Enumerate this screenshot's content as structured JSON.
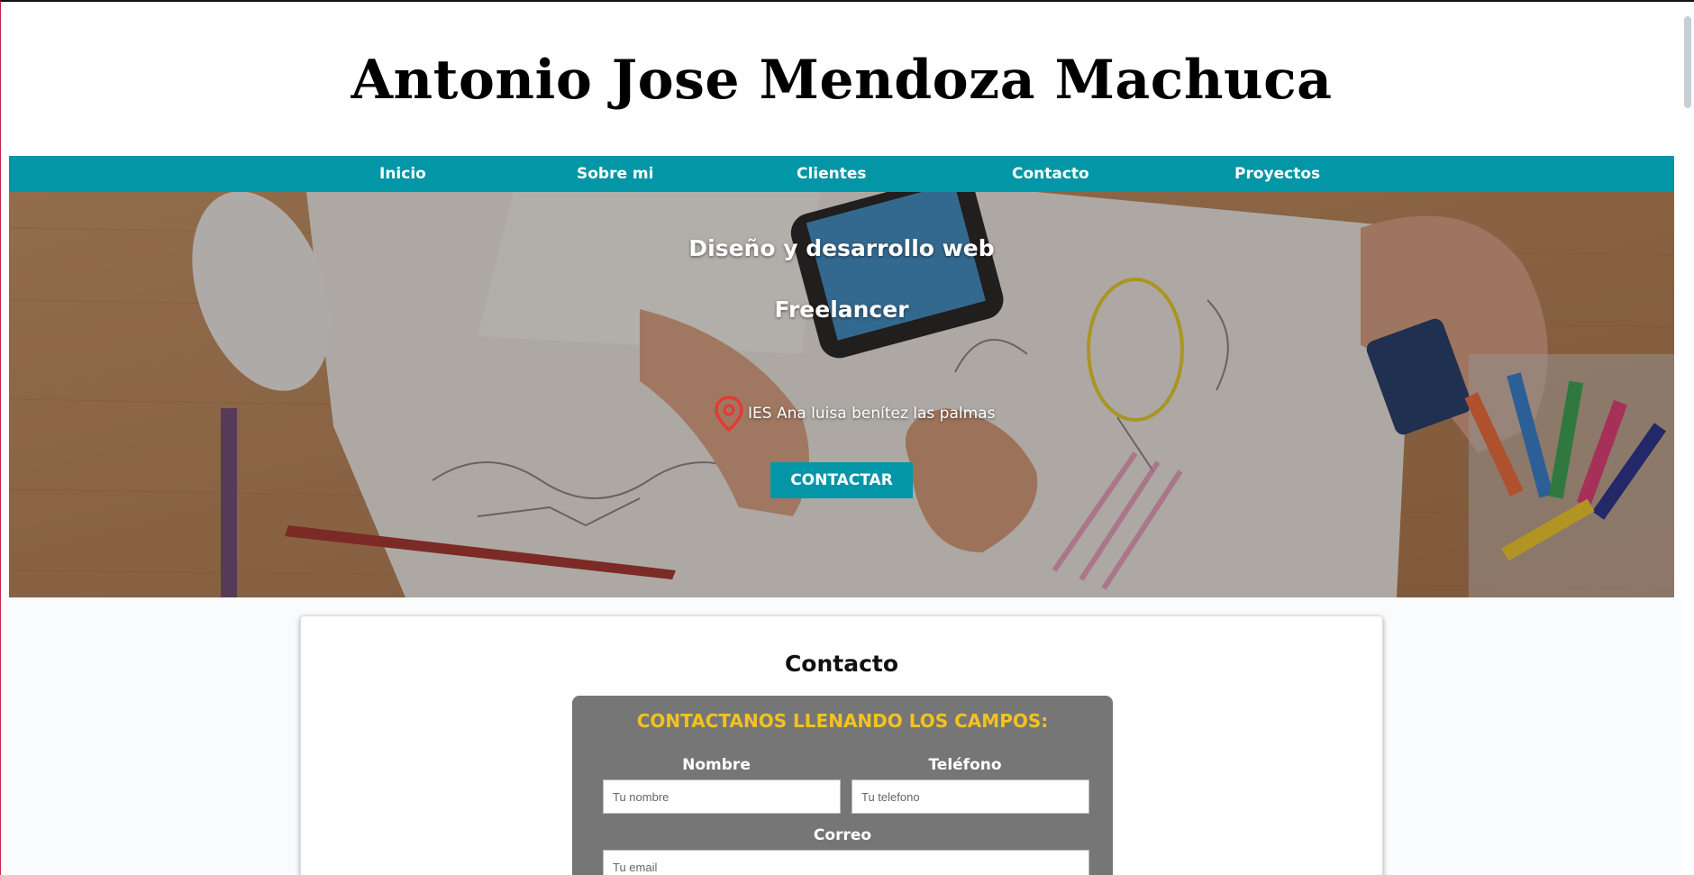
{
  "header": {
    "title": "Antonio Jose Mendoza Machuca"
  },
  "nav": {
    "items": [
      {
        "label": "Inicio"
      },
      {
        "label": "Sobre mi"
      },
      {
        "label": "Clientes"
      },
      {
        "label": "Contacto"
      },
      {
        "label": "Proyectos"
      }
    ],
    "color": "#0396a6"
  },
  "hero": {
    "heading_1": "Diseño y desarrollo web",
    "heading_2": "Freelancer",
    "location": "IES Ana luisa benítez las palmas",
    "location_icon": "map-pin-icon",
    "button_label": "CONTACTAR"
  },
  "contact": {
    "title": "Contacto",
    "form_heading": "CONTACTANOS LLENANDO LOS CAMPOS:",
    "heading_color": "#f4c21e",
    "fields": {
      "name": {
        "label": "Nombre",
        "placeholder": "Tu nombre"
      },
      "phone": {
        "label": "Teléfono",
        "placeholder": "Tu telefono"
      },
      "email": {
        "label": "Correo",
        "placeholder": "Tu email"
      }
    }
  }
}
